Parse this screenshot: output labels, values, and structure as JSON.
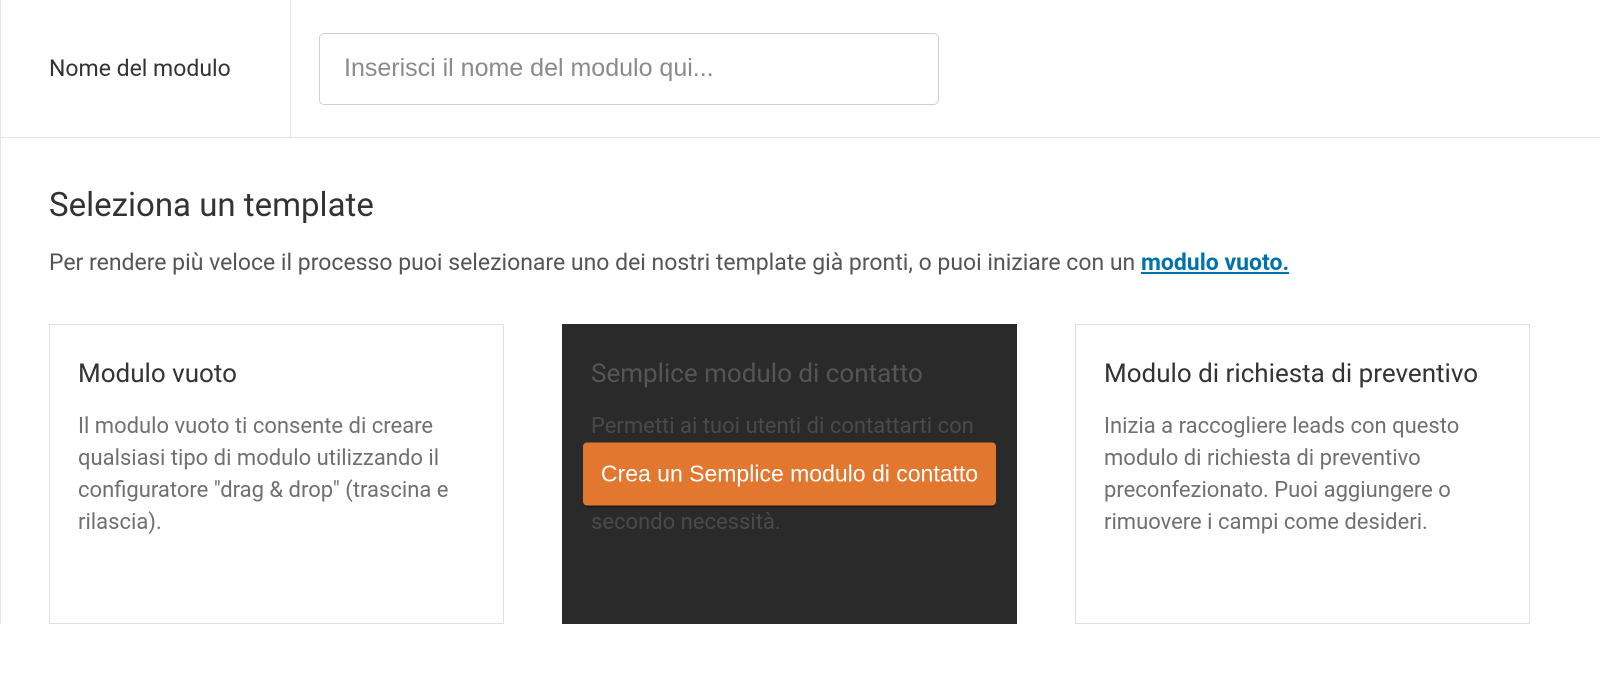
{
  "header": {
    "label": "Nome del modulo",
    "placeholder": "Inserisci il nome del modulo qui..."
  },
  "section": {
    "title": "Seleziona un template",
    "subtitle_prefix": "Per rendere più veloce il processo puoi selezionare uno dei nostri template già pronti, o puoi iniziare con un ",
    "subtitle_link": "modulo vuoto."
  },
  "cards": {
    "blank": {
      "title": "Modulo vuoto",
      "desc": "Il modulo vuoto ti consente di creare qualsiasi tipo di modulo utilizzando il configuratore \"drag & drop\" (trascina e rilascia)."
    },
    "contact": {
      "title": "Semplice modulo di contatto",
      "desc": "Permetti ai tuoi utenti di contattarti con questo semplice modulo di contatto. Puoi aggiungere o rimuovere campi secondo necessità.",
      "button": "Crea un Semplice modulo di contatto"
    },
    "quote": {
      "title": "Modulo di richiesta di preventivo",
      "desc": "Inizia a raccogliere leads con questo modulo di richiesta di preventivo preconfezionato. Puoi aggiungere o rimuovere i campi come desideri."
    }
  }
}
